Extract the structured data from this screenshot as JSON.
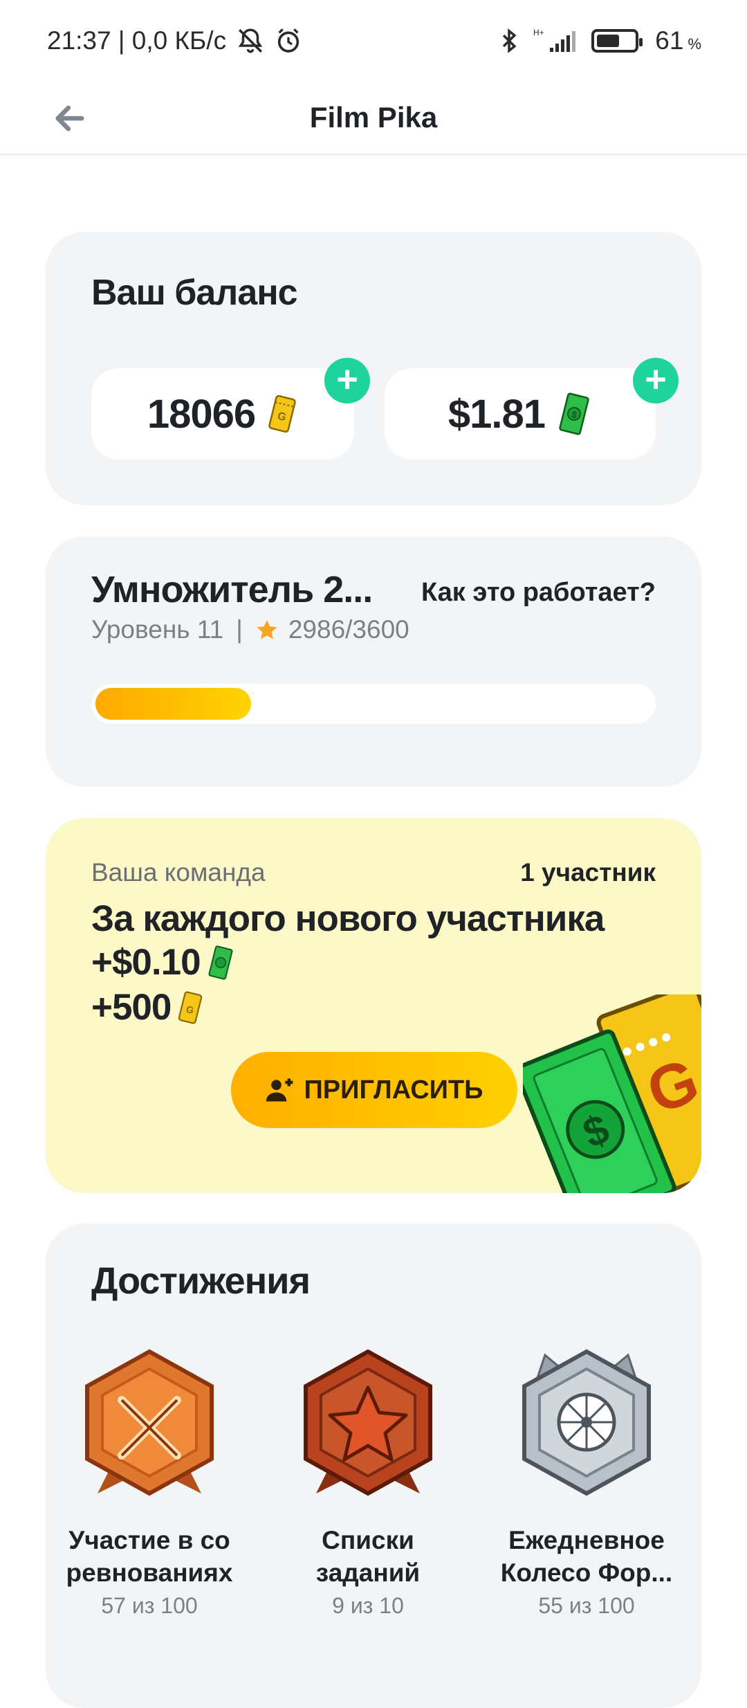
{
  "status_bar": {
    "time_net": "21:37 | 0,0 КБ/с",
    "network_type": "H+",
    "battery_percent": 61,
    "battery_text": "61",
    "battery_unit": "%"
  },
  "header": {
    "title": "Film Pika",
    "back_icon": "arrow-left-icon"
  },
  "balance": {
    "title": "Ваш баланс",
    "coins": "18066",
    "cash": "$1.81"
  },
  "multiplier": {
    "title": "Умножитель 2...",
    "help_link": "Как это работает?",
    "level": "Уровень 11",
    "separator": "|",
    "xp": "2986/3600",
    "progress": 0.28
  },
  "team": {
    "label": "Ваша команда",
    "count": "1 участник",
    "headline": "За каждого нового участника",
    "reward_cash": "+$0.10",
    "reward_coins": "+500",
    "invite_button": "ПРИГЛАСИТЬ"
  },
  "achievements": {
    "title": "Достижения",
    "items": [
      {
        "line1": "Участие в со",
        "line2": "ревнованиях",
        "progress": "57 из 100",
        "icon": "crossed-swords-badge-icon"
      },
      {
        "line1": "Списки",
        "line2": "заданий",
        "progress": "9 из 10",
        "icon": "star-badge-icon"
      },
      {
        "line1": "Ежедневное",
        "line2": "Колесо Фор...",
        "progress": "55 из 100",
        "icon": "fortune-wheel-badge-icon"
      }
    ]
  },
  "colors": {
    "accent_green": "#1fd39c",
    "progress_start": "#ffa800",
    "progress_end": "#ffd400",
    "team_bg": "#fdf8c8"
  }
}
